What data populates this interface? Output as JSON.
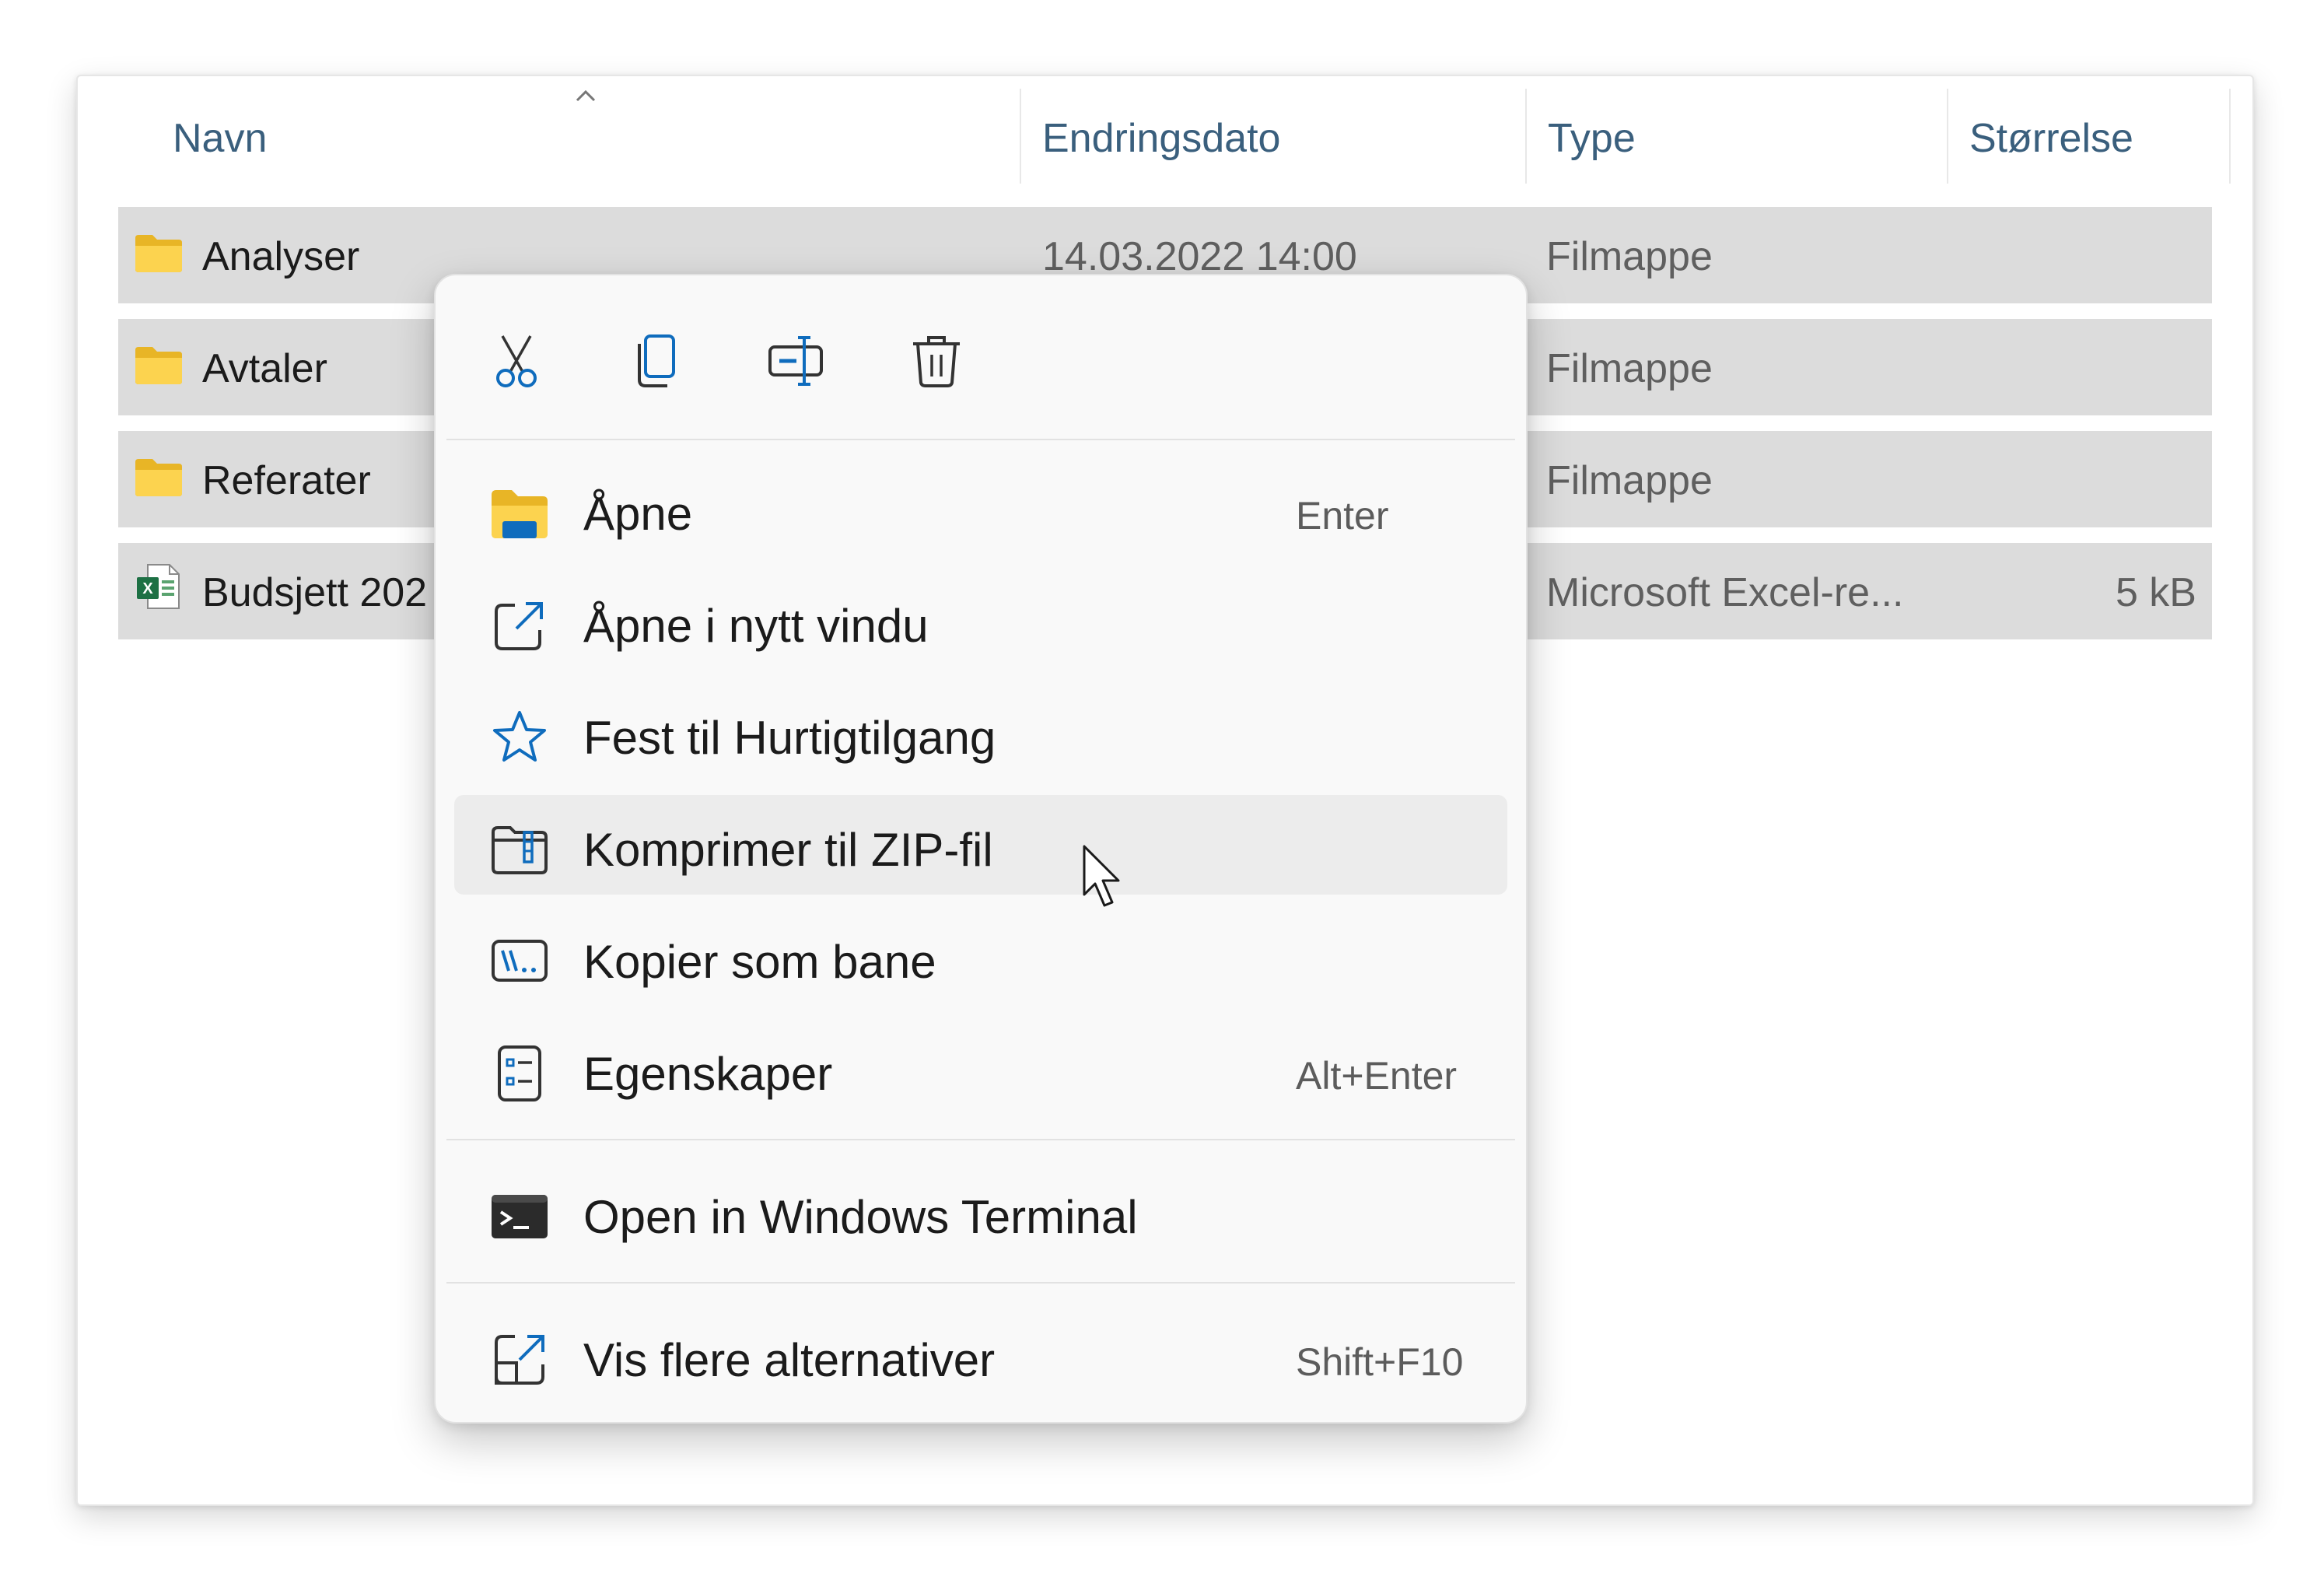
{
  "columns": {
    "name": "Navn",
    "date": "Endringsdato",
    "type": "Type",
    "size": "Størrelse",
    "sort_indicator": "chevron-up-icon"
  },
  "files": [
    {
      "name": "Analyser",
      "date": "14.03.2022 14:00",
      "type": "Filmappe",
      "size": "",
      "icon": "folder-icon"
    },
    {
      "name": "Avtaler",
      "date": "",
      "type": "Filmappe",
      "size": "",
      "icon": "folder-icon"
    },
    {
      "name": "Referater",
      "date": "",
      "type": "Filmappe",
      "size": "",
      "icon": "folder-icon"
    },
    {
      "name": "Budsjett 202",
      "date": "",
      "type": "Microsoft Excel-re...",
      "size": "5 kB",
      "icon": "excel-file-icon"
    }
  ],
  "context_menu": {
    "toolbar": [
      {
        "name": "cut",
        "icon": "scissors-icon"
      },
      {
        "name": "copy",
        "icon": "copy-icon"
      },
      {
        "name": "rename",
        "icon": "rename-icon"
      },
      {
        "name": "delete",
        "icon": "trash-icon"
      }
    ],
    "items": [
      {
        "label": "Åpne",
        "shortcut": "Enter",
        "icon": "folder-open-icon"
      },
      {
        "label": "Åpne i nytt vindu",
        "shortcut": "",
        "icon": "open-new-window-icon"
      },
      {
        "label": "Fest til Hurtigtilgang",
        "shortcut": "",
        "icon": "star-icon"
      },
      {
        "label": "Komprimer til ZIP-fil",
        "shortcut": "",
        "icon": "zip-folder-icon",
        "hovered": true
      },
      {
        "label": "Kopier som bane",
        "shortcut": "",
        "icon": "copy-path-icon"
      },
      {
        "label": "Egenskaper",
        "shortcut": "Alt+Enter",
        "icon": "properties-icon"
      },
      {
        "label": "Open in Windows Terminal",
        "shortcut": "",
        "icon": "terminal-icon"
      },
      {
        "label": "Vis flere alternativer",
        "shortcut": "Shift+F10",
        "icon": "more-options-icon"
      }
    ]
  },
  "colors": {
    "accent": "#0f6cbd",
    "folder": "#f8c93a",
    "excel": "#1d7044",
    "selection": "#dcdcdc",
    "menu_hover": "#ececec"
  }
}
